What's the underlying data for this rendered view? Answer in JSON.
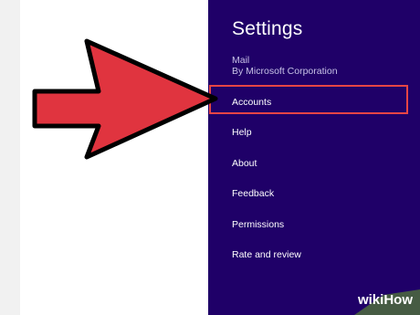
{
  "settings": {
    "title": "Settings",
    "app_name": "Mail",
    "publisher": "By Microsoft Corporation"
  },
  "menu": [
    {
      "label": "Accounts",
      "highlighted": true
    },
    {
      "label": "Help"
    },
    {
      "label": "About"
    },
    {
      "label": "Feedback"
    },
    {
      "label": "Permissions"
    },
    {
      "label": "Rate and review"
    }
  ],
  "watermark": {
    "wiki": "wiki",
    "how": "How"
  },
  "colors": {
    "pane_bg": "#1f0068",
    "highlight": "#e64545",
    "arrow_fill": "#e0343f"
  }
}
